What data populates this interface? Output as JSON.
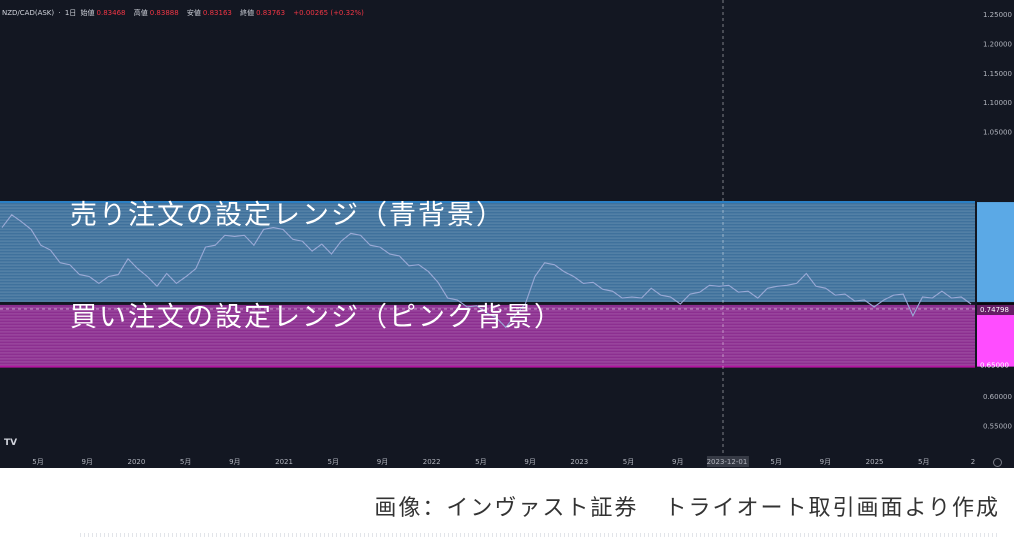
{
  "header": {
    "symbol": "NZD/CAD(ASK)",
    "separator": "·",
    "interval": "1日",
    "open_label": "始値",
    "open_value": "0.83468",
    "high_label": "高値",
    "high_value": "0.83888",
    "low_label": "安値",
    "low_value": "0.83163",
    "close_label": "終値",
    "close_value": "0.83763",
    "change": "+0.00265 (+0.32%)"
  },
  "overlays": {
    "sell_label": "売り注文の設定レンジ（青背景）",
    "buy_label": "買い注文の設定レンジ（ピンク背景）"
  },
  "caption": {
    "source": "画像：インヴァスト証券",
    "description": "トライオート取引画面より作成"
  },
  "logo": "TV",
  "colors": {
    "background": "#131722",
    "sell_zone": "#5ba9e6",
    "buy_zone": "#d63fd3",
    "price_line": "#9aa9d6",
    "axis_text": "#b2b5be",
    "crosshair_label_bg": "#363a45"
  },
  "chart_data": {
    "type": "line",
    "title": "",
    "xlabel": "",
    "ylabel": "",
    "y_ticks": [
      "1.25000",
      "1.20000",
      "1.15000",
      "1.10000",
      "1.05000",
      "0.60000",
      "0.55000"
    ],
    "y_current_label": "0.74798",
    "y_zone_bottom_label": "0.65000",
    "ylim": [
      0.53,
      1.27
    ],
    "sell_zone_range": [
      0.76,
      0.93
    ],
    "buy_zone_range": [
      0.65,
      0.755
    ],
    "x_ticks": [
      "5月",
      "9月",
      "2020",
      "5月",
      "9月",
      "2021",
      "5月",
      "9月",
      "2022",
      "5月",
      "9月",
      "2023",
      "5月",
      "9月",
      "2023-12-01",
      "5月",
      "9月",
      "2025",
      "5月",
      "2"
    ],
    "crosshair_x_label": "2023-12-01",
    "series": [
      {
        "values": [
          0.89,
          0.905,
          0.9,
          0.88,
          0.86,
          0.845,
          0.83,
          0.82,
          0.81,
          0.8,
          0.795,
          0.8,
          0.81,
          0.83,
          0.82,
          0.8,
          0.79,
          0.805,
          0.795,
          0.8,
          0.82,
          0.85,
          0.86,
          0.87,
          0.875,
          0.87,
          0.86,
          0.88,
          0.89,
          0.88,
          0.87,
          0.86,
          0.85,
          0.855,
          0.845,
          0.86,
          0.88,
          0.87,
          0.86,
          0.85,
          0.845,
          0.835,
          0.825,
          0.82,
          0.815,
          0.79,
          0.77,
          0.76,
          0.755,
          0.75,
          0.745,
          0.73,
          0.72,
          0.735,
          0.76,
          0.8,
          0.83,
          0.82,
          0.815,
          0.8,
          0.795,
          0.79,
          0.785,
          0.775,
          0.77,
          0.765,
          0.77,
          0.78,
          0.775,
          0.765,
          0.76,
          0.77,
          0.78,
          0.785,
          0.79,
          0.785,
          0.78,
          0.775,
          0.77,
          0.78,
          0.79,
          0.785,
          0.795,
          0.805,
          0.79,
          0.78,
          0.775,
          0.77,
          0.765,
          0.76,
          0.755,
          0.76,
          0.775,
          0.77,
          0.74,
          0.765,
          0.77,
          0.775,
          0.77,
          0.765,
          0.76
        ]
      }
    ],
    "grid": false
  }
}
